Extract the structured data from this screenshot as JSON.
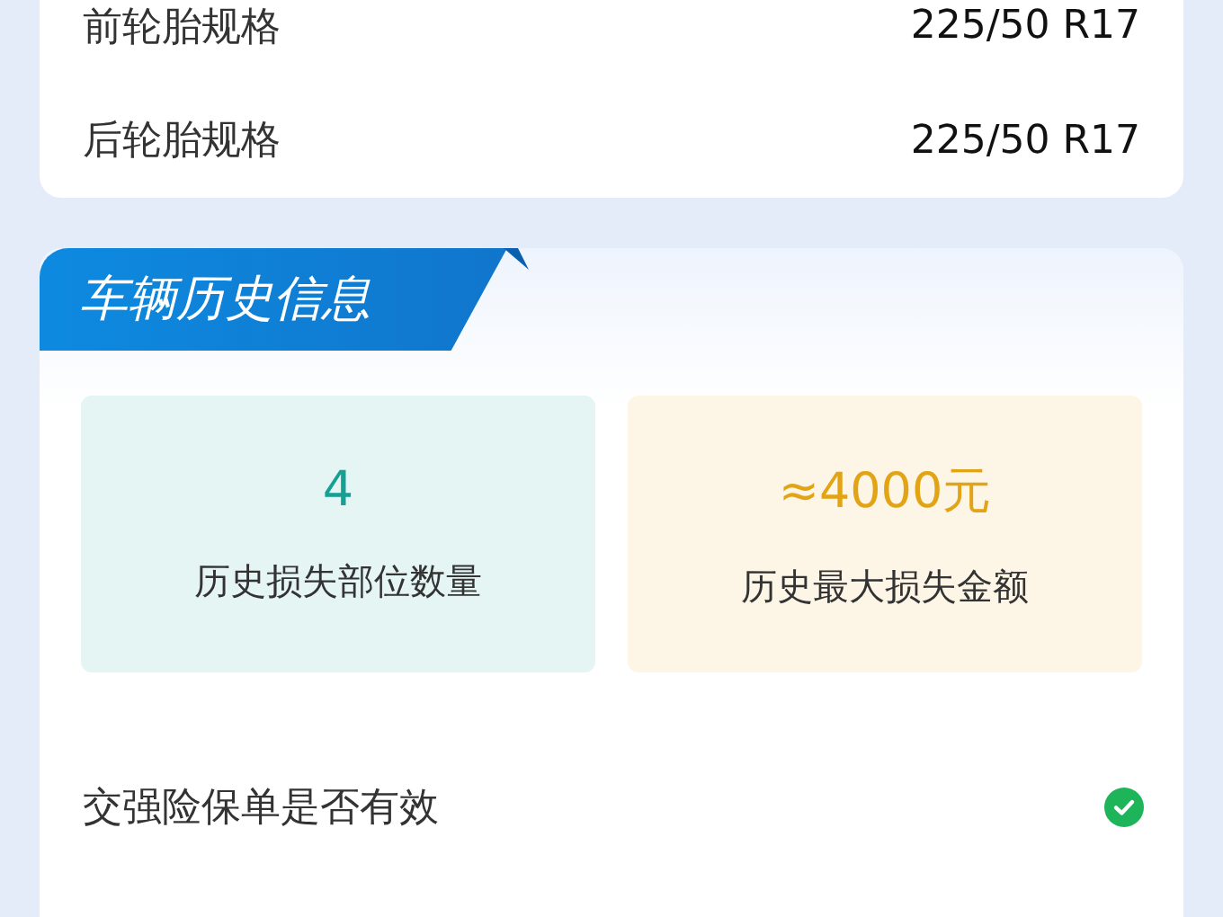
{
  "specs": [
    {
      "label": "前轮胎规格",
      "value": "225/50 R17"
    },
    {
      "label": "后轮胎规格",
      "value": "225/50 R17"
    }
  ],
  "history": {
    "title": "车辆历史信息",
    "stats": [
      {
        "kind": "count",
        "value": "4",
        "label": "历史损失部位数量"
      },
      {
        "kind": "amount",
        "value": "≈4000元",
        "label": "历史最大损失金额"
      }
    ],
    "checks": [
      {
        "label": "交强险保单是否有效",
        "valid": true
      }
    ]
  }
}
